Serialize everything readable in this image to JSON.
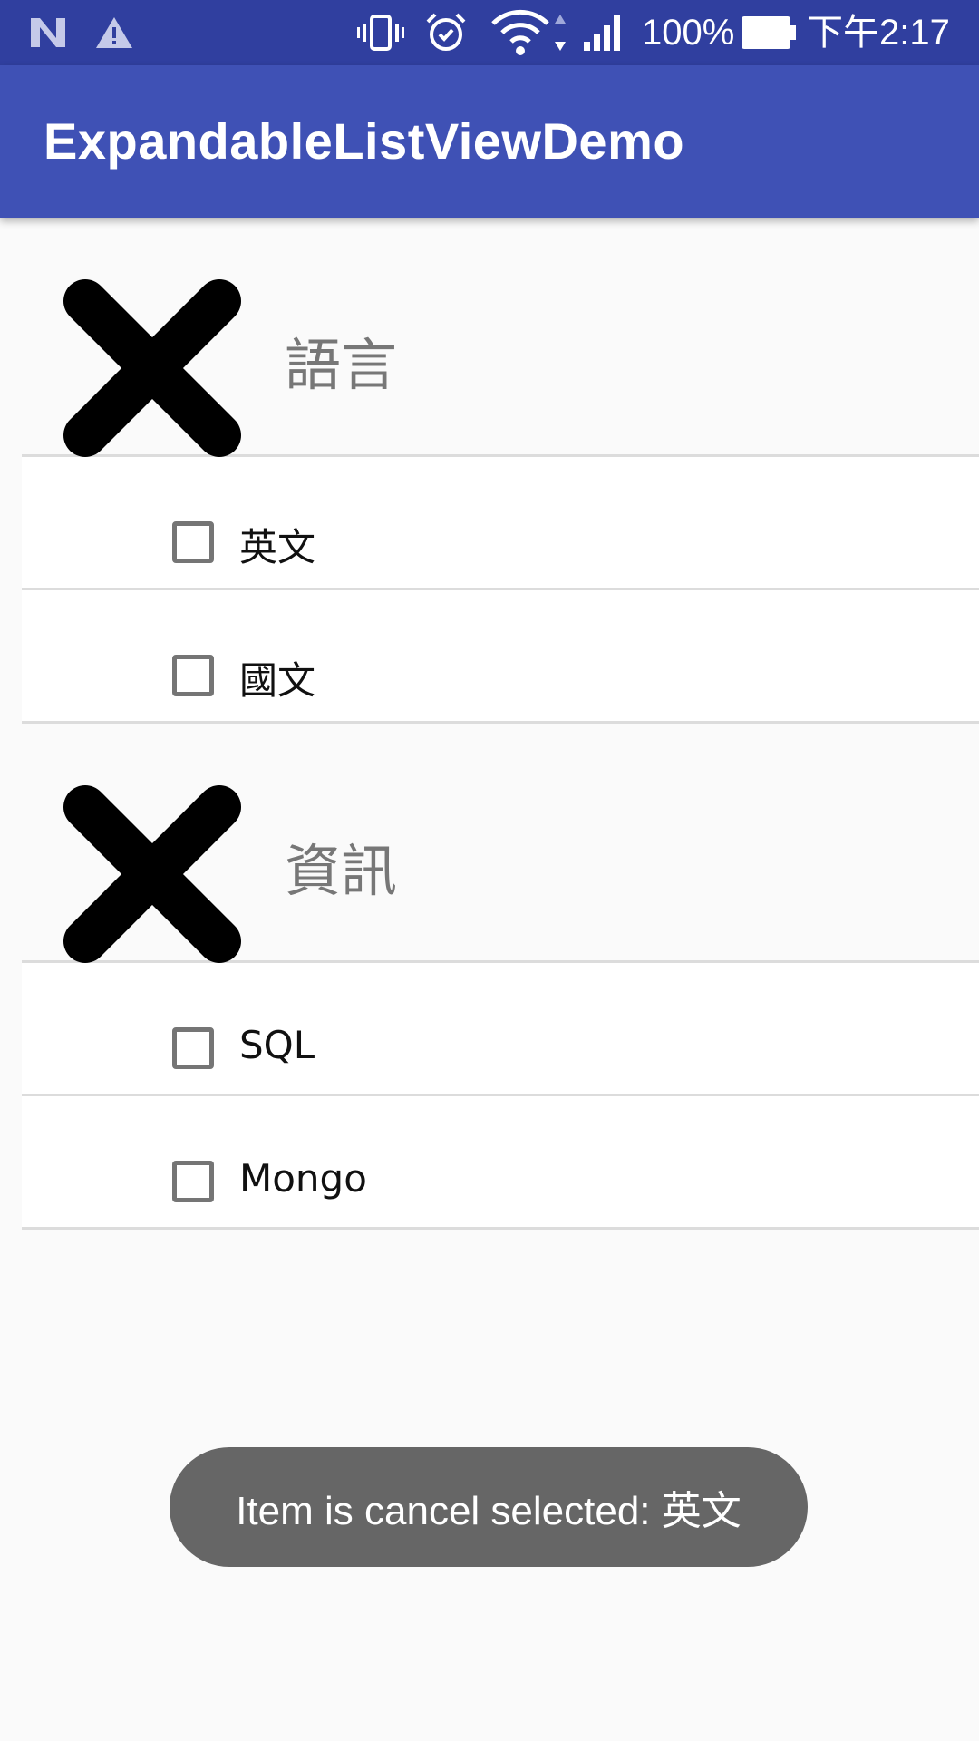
{
  "status_bar": {
    "battery_text": "100%",
    "time": "下午2:17",
    "icons": [
      "notification-n-icon",
      "warning-icon",
      "vibrate-icon",
      "alarm-icon",
      "wifi-icon",
      "signal-icon",
      "battery-icon"
    ]
  },
  "app_bar": {
    "title": "ExpandableListViewDemo"
  },
  "groups": [
    {
      "label": "語言",
      "icon": "close-icon",
      "children": [
        "英文",
        "國文"
      ]
    },
    {
      "label": "資訊",
      "icon": "close-icon",
      "children": [
        "SQL",
        "Mongo"
      ]
    }
  ],
  "toast": {
    "message": "Item is cancel selected: 英文"
  },
  "colors": {
    "status_bar": "#303f9f",
    "app_bar": "#3f51b5",
    "toast": "#666666"
  }
}
